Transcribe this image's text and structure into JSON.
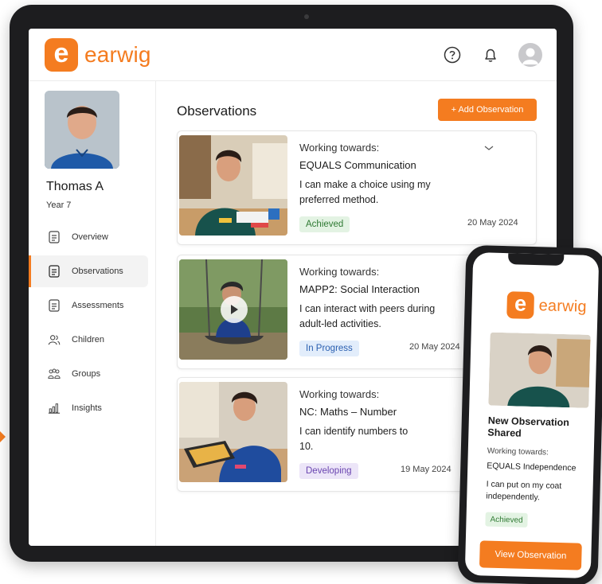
{
  "brand": {
    "logo_letter": "e",
    "name": "earwig",
    "accent_color": "#f47c20"
  },
  "header": {
    "icons": [
      "help-icon",
      "bell-icon",
      "user-avatar-icon"
    ]
  },
  "profile": {
    "name": "Thomas A",
    "year": "Year 7"
  },
  "sidebar": {
    "items": [
      {
        "label": "Overview",
        "icon": "document-icon",
        "active": false
      },
      {
        "label": "Observations",
        "icon": "document-icon",
        "active": true
      },
      {
        "label": "Assessments",
        "icon": "document-icon",
        "active": false
      },
      {
        "label": "Children",
        "icon": "people-icon",
        "active": false
      },
      {
        "label": "Groups",
        "icon": "group-icon",
        "active": false
      },
      {
        "label": "Insights",
        "icon": "bar-chart-icon",
        "active": false
      }
    ]
  },
  "main": {
    "title": "Observations",
    "add_button": "+ Add Observation",
    "observations": [
      {
        "working_towards": "Working towards:",
        "goal": "EQUALS Communication",
        "description": "I can make a choice using my preferred method.",
        "status": "Achieved",
        "status_color": "green",
        "date": "20 May 2024"
      },
      {
        "working_towards": "Working towards:",
        "goal": "MAPP2: Social Interaction",
        "description": "I can interact with peers during adult-led activities.",
        "status": "In Progress",
        "status_color": "blue",
        "date": "20 May 2024"
      },
      {
        "working_towards": "Working towards:",
        "goal": "NC: Maths – Number",
        "description": "I can identify numbers to 10.",
        "status": "Developing",
        "status_color": "purple",
        "date": "19 May 2024"
      }
    ]
  },
  "phone": {
    "title": "New Observation Shared",
    "working_towards": "Working towards:",
    "goal": "EQUALS Independence",
    "description": "I can put on my coat independently.",
    "status": "Achieved",
    "button": "View Observation"
  }
}
